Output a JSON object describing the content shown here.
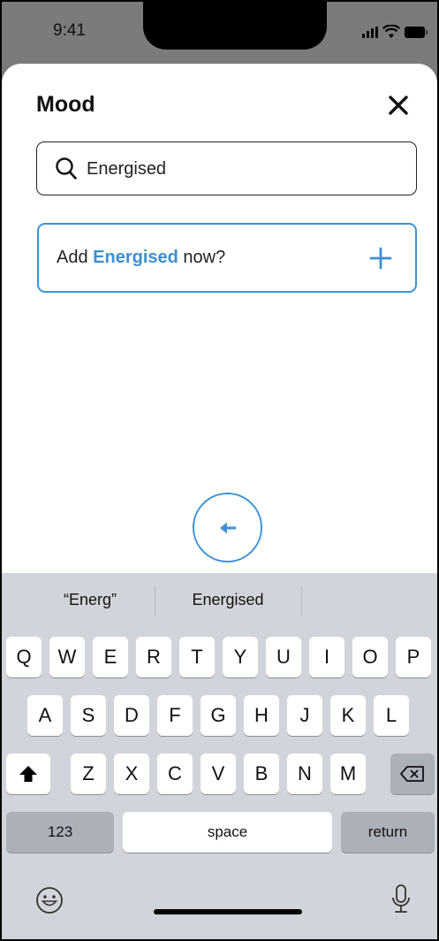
{
  "status_bar": {
    "time": "9:41"
  },
  "sheet": {
    "title": "Mood",
    "search": {
      "value": "Energised"
    },
    "add_prompt": {
      "prefix": "Add ",
      "mood": "Energised",
      "suffix": " now?"
    }
  },
  "keyboard": {
    "suggestions": [
      "“Energ”",
      "Energised",
      ""
    ],
    "row1": [
      "Q",
      "W",
      "E",
      "R",
      "T",
      "Y",
      "U",
      "I",
      "O",
      "P"
    ],
    "row2": [
      "A",
      "S",
      "D",
      "F",
      "G",
      "H",
      "J",
      "K",
      "L"
    ],
    "row3": [
      "Z",
      "X",
      "C",
      "V",
      "B",
      "N",
      "M"
    ],
    "numbers_label": "123",
    "space_label": "space",
    "return_label": "return"
  },
  "colors": {
    "accent": "#3e93d6",
    "keyboard_bg": "#d1d4da",
    "dark_key": "#acb0b9"
  },
  "icons": [
    "signal-icon",
    "wifi-icon",
    "battery-icon",
    "close-icon",
    "search-icon",
    "plus-icon",
    "back-arrow-icon",
    "shift-icon",
    "backspace-icon",
    "emoji-icon",
    "microphone-icon"
  ]
}
